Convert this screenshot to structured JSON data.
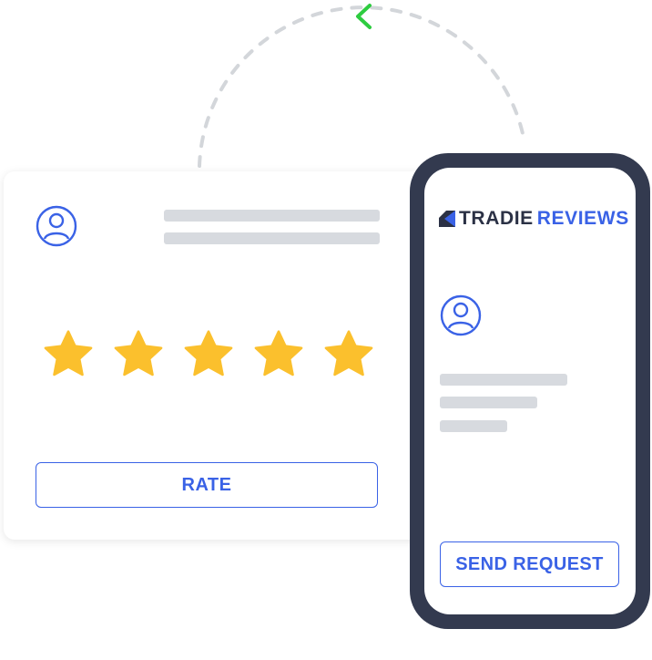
{
  "colors": {
    "accent": "#3a62e6",
    "star": "#fbc02d",
    "phone_frame": "#333a4f",
    "placeholder": "#d7dadf",
    "arc": "#d3d6da",
    "arrow": "#2ecc40"
  },
  "icons": {
    "avatar": "user-circle-icon",
    "star": "star-icon",
    "arrow": "chevron-left-icon",
    "logo": "tradie-reviews-logo-icon"
  },
  "review_card": {
    "rating": 5,
    "max_rating": 5,
    "rate_button_label": "RATE"
  },
  "phone": {
    "brand_word1": "TRADIE",
    "brand_word2": "REVIEWS",
    "send_button_label": "SEND REQUEST"
  }
}
